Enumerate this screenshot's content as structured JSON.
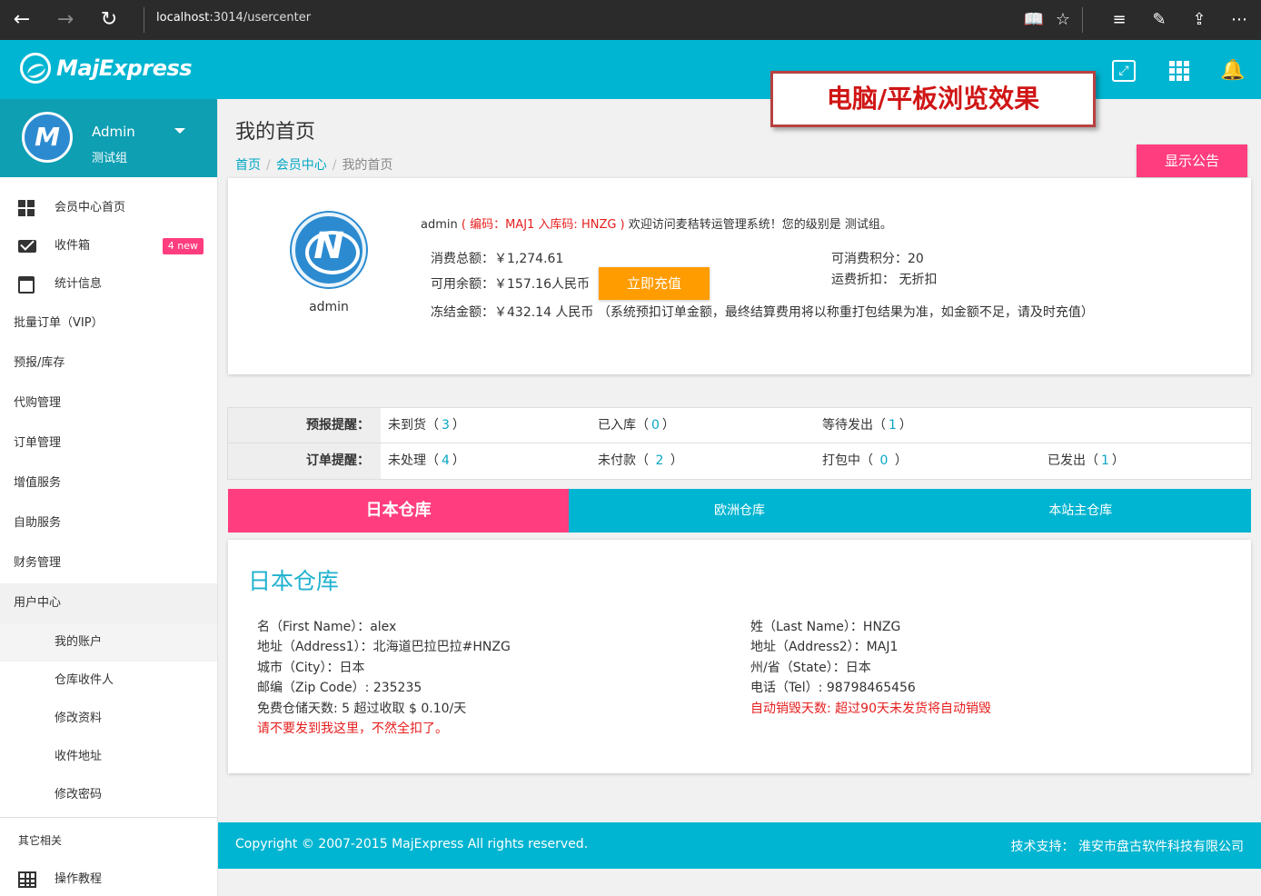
{
  "browser": {
    "url_host": "localhost",
    "url_path": ":3014/usercenter",
    "back_glyph": "←",
    "forward_glyph": "→",
    "refresh_glyph": "↻",
    "reading_glyph": "📖",
    "favorite_glyph": "☆",
    "hub_glyph": "≡",
    "note_glyph": "✎",
    "share_glyph": "⇪",
    "more_glyph": "⋯"
  },
  "header": {
    "logo_text": "MajExpress",
    "bell_glyph": "🔔",
    "overlay_label": "电脑/平板浏览效果"
  },
  "sidebar": {
    "user_name": "Admin",
    "user_group": "测试组",
    "items": [
      {
        "label": "会员中心首页"
      },
      {
        "label": "收件箱",
        "badge": "4 new"
      },
      {
        "label": "统计信息"
      },
      {
        "label": "批量订单（VIP）"
      },
      {
        "label": "预报/库存"
      },
      {
        "label": "代购管理"
      },
      {
        "label": "订单管理"
      },
      {
        "label": "增值服务"
      },
      {
        "label": "自助服务"
      },
      {
        "label": "财务管理"
      },
      {
        "label": "用户中心"
      }
    ],
    "sub_items": [
      {
        "label": "我的账户"
      },
      {
        "label": "仓库收件人"
      },
      {
        "label": "修改资料"
      },
      {
        "label": "收件地址"
      },
      {
        "label": "修改密码"
      }
    ],
    "other_label": "其它相关",
    "tutorial_label": "操作教程"
  },
  "main": {
    "page_title": "我的首页",
    "breadcrumb": [
      "首页",
      "会员中心",
      "我的首页"
    ],
    "breadcrumb_sep": "/",
    "notice_button": "显示公告",
    "user": {
      "avatar_caption": "admin",
      "welcome_name": "admin",
      "welcome_codes": "( 编码：MAJ1 入库码: HNZG )",
      "welcome_text": "欢迎访问麦秸转运管理系统！您的级别是 测试组。",
      "total_spent": "消费总额：￥1,274.61",
      "available_balance": "可用余额：￥157.16人民币",
      "recharge_button": "立即充值",
      "frozen": "冻结金额：￥432.14 人民币 （系统预扣订单金额，最终结算费用将以称重打包结果为准，如金额不足，请及时充值）",
      "points": "可消费积分：20",
      "discount": "运费折扣： 无折扣"
    },
    "reminders": {
      "forecast_head": "预报提醒：",
      "forecast": [
        {
          "label": "未到货（",
          "count": "3",
          "close": "）"
        },
        {
          "label": "已入库（",
          "count": "0",
          "close": "）"
        },
        {
          "label": "等待发出（",
          "count": "1",
          "close": "）"
        }
      ],
      "order_head": "订单提醒：",
      "orders": [
        {
          "label": "未处理（",
          "count": "4",
          "close": "）"
        },
        {
          "label": "未付款（ ",
          "count": "2",
          "close": " ）"
        },
        {
          "label": "打包中（ ",
          "count": "0",
          "close": " ）"
        },
        {
          "label": "已发出（",
          "count": "1",
          "close": "）"
        }
      ]
    },
    "tabs": [
      "日本仓库",
      "欧洲仓库",
      "本站主仓库"
    ],
    "warehouse": {
      "title": "日本仓库",
      "first_name": "名（First Name）：alex",
      "address1": "地址（Address1）：北海道巴拉巴拉#HNZG",
      "city": "城市（City）：日本",
      "zip": "邮编（Zip Code）: 235235",
      "free_days": "免费仓储天数: 5 超过收取 $ 0.10/天",
      "warning": "请不要发到我这里，不然全扣了。",
      "last_name": "姓（Last Name）：HNZG",
      "address2": "地址（Address2）：MAJ1",
      "state": "州/省（State）：日本",
      "tel": "电话（Tel）: 98798465456",
      "auto_destroy": "自动销毁天数: 超过90天未发货将自动销毁"
    },
    "footer": {
      "copyright": "Copyright © 2007-2015 MajExpress All rights reserved.",
      "support": "技术支持： 淮安市盘古软件科技有限公司"
    }
  }
}
